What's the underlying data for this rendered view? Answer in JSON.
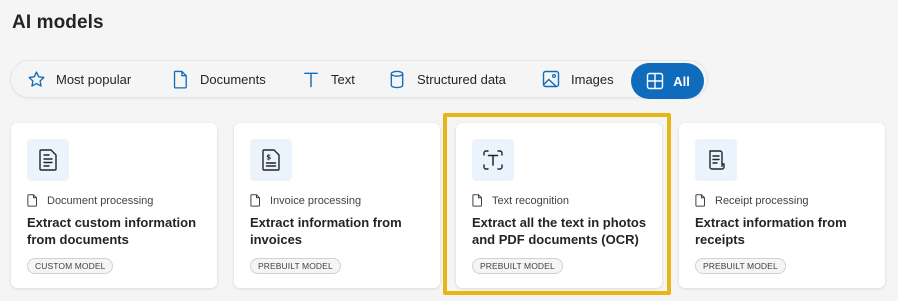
{
  "page": {
    "title": "AI models"
  },
  "filters": [
    {
      "label": "Most popular",
      "icon": "star-icon"
    },
    {
      "label": "Documents",
      "icon": "document-icon"
    },
    {
      "label": "Text",
      "icon": "text-icon"
    },
    {
      "label": "Structured data",
      "icon": "database-icon"
    },
    {
      "label": "Images",
      "icon": "image-icon"
    },
    {
      "label": "All",
      "icon": "grid-icon",
      "active": true
    }
  ],
  "cards": [
    {
      "category": "Document processing",
      "title": "Extract custom information from documents",
      "badge": "CUSTOM MODEL",
      "icon": "document-text-icon"
    },
    {
      "category": "Invoice processing",
      "title": "Extract information from invoices",
      "badge": "PREBUILT MODEL",
      "icon": "invoice-icon"
    },
    {
      "category": "Text recognition",
      "title": "Extract all the text in photos and PDF documents (OCR)",
      "badge": "PREBUILT MODEL",
      "icon": "text-recognition-icon",
      "highlighted": true
    },
    {
      "category": "Receipt processing",
      "title": "Extract information from receipts",
      "badge": "PREBUILT MODEL",
      "icon": "receipt-icon"
    }
  ],
  "colors": {
    "accent": "#0f6cbd",
    "highlight": "#e8b516",
    "icon_tile": "#ebf3fc"
  }
}
